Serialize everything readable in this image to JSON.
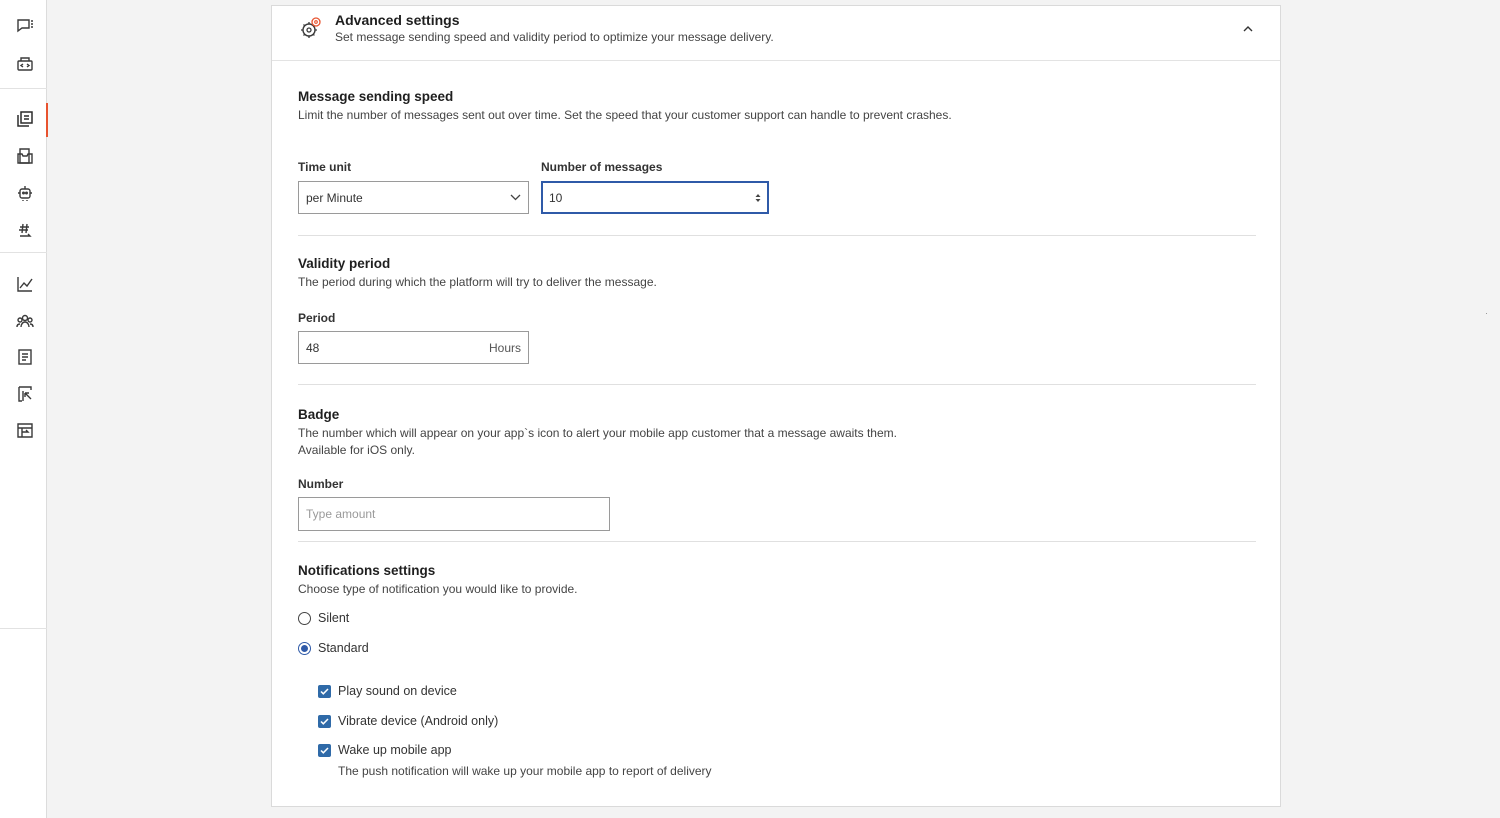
{
  "header": {
    "title": "Advanced settings",
    "subtitle": "Set message sending speed and validity period to optimize your message delivery."
  },
  "speed": {
    "title": "Message sending speed",
    "description": "Limit the number of messages sent out over time. Set the speed that your customer support can handle to prevent crashes.",
    "time_unit_label": "Time unit",
    "time_unit_value": "per Minute",
    "number_label": "Number of messages",
    "number_value": "10"
  },
  "validity": {
    "title": "Validity period",
    "description": "The period during which the platform will try to deliver the message.",
    "period_label": "Period",
    "period_value": "48",
    "period_unit": "Hours"
  },
  "badge": {
    "title": "Badge",
    "description_line1": "The number which will appear on your app`s icon to alert your mobile app customer that a message awaits them.",
    "description_line2": "Available for iOS only.",
    "number_label": "Number",
    "number_placeholder": "Type amount"
  },
  "notifications": {
    "title": "Notifications settings",
    "description": "Choose type of notification you would like to provide.",
    "options": [
      {
        "label": "Silent",
        "selected": false
      },
      {
        "label": "Standard",
        "selected": true
      }
    ],
    "checks": [
      {
        "label": "Play sound on device",
        "checked": true
      },
      {
        "label": "Vibrate device (Android only)",
        "checked": true
      },
      {
        "label": "Wake up mobile app",
        "checked": true
      }
    ],
    "wake_hint": "The push notification will wake up your mobile app to report of delivery"
  },
  "rail": {
    "icons": [
      "chat-icon",
      "code-box-icon",
      "copy-docs-icon",
      "inbox-icon",
      "bot-icon",
      "hashtag-swap-icon",
      "analytics-icon",
      "people-icon",
      "notebook-icon",
      "report-icon",
      "store-icon"
    ],
    "active": "copy-docs-icon"
  },
  "colors": {
    "accent": "#2f5aa8",
    "active_marker": "#e8532f",
    "checkbox": "#2f6aa8"
  }
}
